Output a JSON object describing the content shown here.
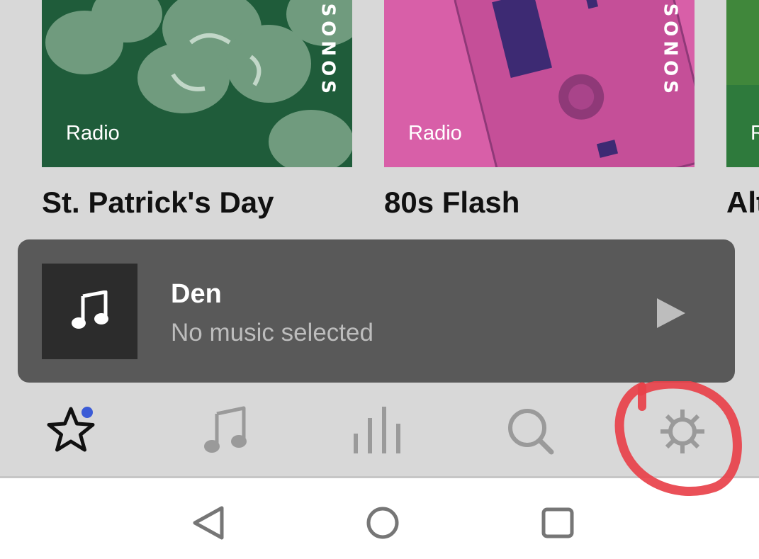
{
  "cards": [
    {
      "badge": "Radio",
      "brand": "SONOS",
      "title": "St. Patrick's Day",
      "tint": "#1f5c3a"
    },
    {
      "badge": "Radio",
      "brand": "SONOS",
      "title": "80s Flash",
      "tint": "#d85fa8"
    },
    {
      "badge": "R",
      "title": "Alt",
      "tint": "#2e7a3c"
    }
  ],
  "miniplayer": {
    "room": "Den",
    "status": "No music selected",
    "thumb_icon": "music-note-icon",
    "play_icon": "play-icon"
  },
  "tabs": [
    {
      "name": "tab-my-sonos",
      "icon": "star-icon",
      "selected": true,
      "has_badge": true
    },
    {
      "name": "tab-browse",
      "icon": "music-note-icon",
      "selected": false
    },
    {
      "name": "tab-rooms",
      "icon": "equalizer-bars-icon",
      "selected": false
    },
    {
      "name": "tab-search",
      "icon": "search-icon",
      "selected": false
    },
    {
      "name": "tab-settings",
      "icon": "gear-icon",
      "selected": false,
      "annotated": true
    }
  ],
  "system_nav": [
    "back-icon",
    "home-icon",
    "recents-icon"
  ],
  "colors": {
    "badge": "#3b5bd6",
    "annotation": "#e8414a",
    "miniplayer_bg": "#595959",
    "tabbar_bg": "#d8d8d8"
  }
}
